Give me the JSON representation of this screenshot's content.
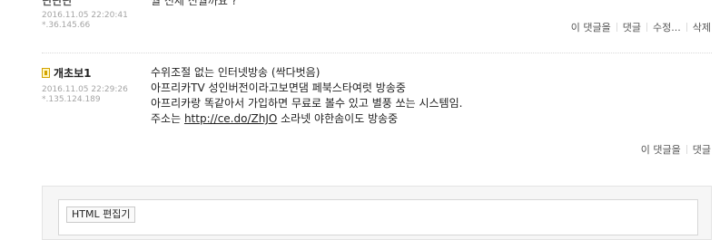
{
  "comment_prev": {
    "nickname_partial": "닌닌닌",
    "body_partial": "월 신세 신월까요 ?",
    "datetime": "2016.11.05 22:20:41",
    "ip": "*.36.145.66",
    "actions": [
      "이 댓글을",
      "댓글",
      "수정...",
      "삭제"
    ]
  },
  "comment": {
    "author": "개초보1",
    "level_icon": "level-icon",
    "datetime": "2016.11.05 22:29:26",
    "ip": "*.135.124.189",
    "lines": [
      "수위조절 없는 인터넷방송 (싹다벗음)",
      "아프리카TV 성인버전이라고보면댐 페북스타여럿 방송중",
      "아프리카랑 똑같아서 가입하면 무료로 볼수 있고 별풍 쏘는 시스템임."
    ],
    "last_line_prefix": "주소는 ",
    "link_text": "http://ce.do/ZhJO",
    "last_line_suffix": " 소라넷 야한솜이도 방송중",
    "actions": [
      "이 댓글을",
      "댓글"
    ]
  },
  "editor": {
    "tab_label": "HTML 편집기"
  }
}
